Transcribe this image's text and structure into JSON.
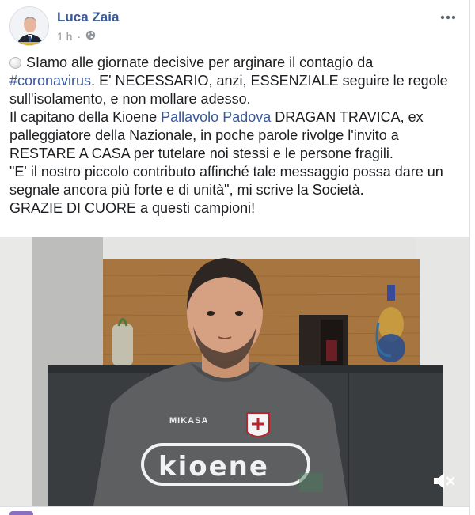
{
  "post": {
    "author": "Luca Zaia",
    "time": "1 h",
    "privacy_icon": "globe-icon",
    "avatar_caption": "#ORGOGLIOVENETO",
    "menu_icon": "more-options-icon"
  },
  "content": {
    "line1": "SIamo alle giornate decisive per arginare il contagio da",
    "hashtag": "#coronavirus",
    "line2_rest": ". E' NECESSARIO, anzi, ESSENZIALE seguire le regole",
    "line3": "sull'isolamento, e non mollare adesso.",
    "line4_start": "Il capitano della Kioene ",
    "page_link": "Pallavolo Padova",
    "line4_end": " DRAGAN TRAVICA, ex",
    "line5": "palleggiatore della Nazionale, in poche parole rivolge l'invito a",
    "line6": "RESTARE A CASA per tutelare noi stessi e le persone fragili.",
    "line7": "\"E' il nostro piccolo contributo affinché tale messaggio possa dare un",
    "line8": "segnale ancora più forte e di unità\", mi scrive la Società.",
    "line9": "GRAZIE DI CUORE a questi campioni!"
  },
  "video": {
    "shirt_brand": "MIKASA",
    "shirt_sponsor": "Kioene",
    "mute_icon": "speaker-muted-icon"
  },
  "colors": {
    "link": "#385898",
    "meta": "#90949c",
    "text": "#1c1e21"
  }
}
